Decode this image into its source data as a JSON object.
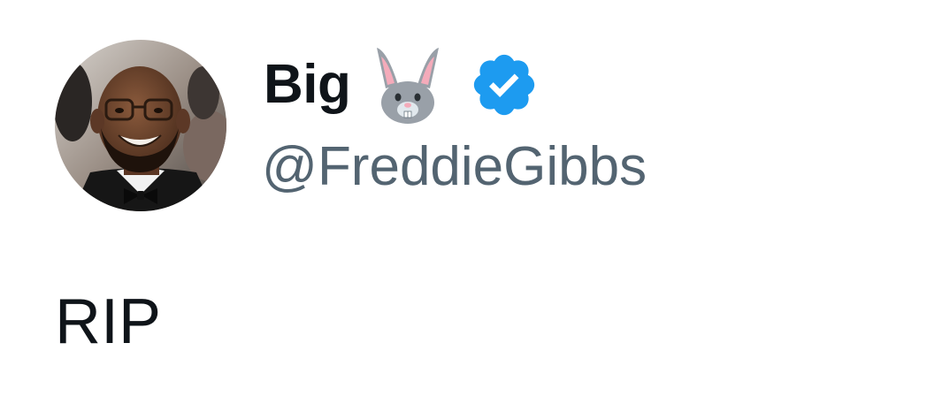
{
  "author": {
    "display_name": "Big",
    "name_emoji": "rabbit-face-icon",
    "verified_badge": "verified-badge-icon",
    "handle": "@FreddieGibbs",
    "avatar": "profile-photo"
  },
  "tweet": {
    "text": "RIP"
  },
  "colors": {
    "name_text": "#0f1419",
    "handle_text": "#536471",
    "verified_blue": "#1d9bf0",
    "background": "#ffffff"
  }
}
